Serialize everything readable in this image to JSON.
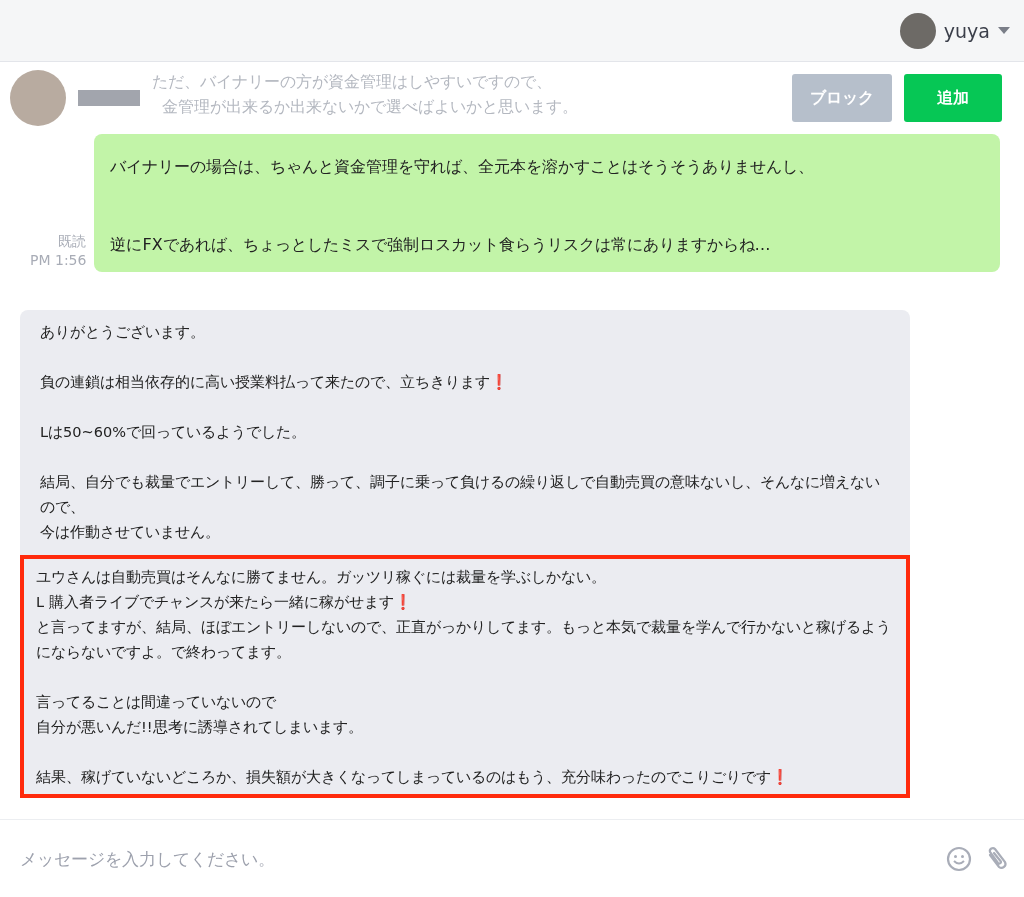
{
  "user_menu": {
    "name": "yuya"
  },
  "faded_message": [
    "ただ、バイナリーの方が資金管理はしやすいですので、",
    "金管理が出来るか出来ないかで選べばよいかと思います。"
  ],
  "contact": {
    "buttons": [
      {
        "kind": "block",
        "label": "ブロック"
      },
      {
        "kind": "add",
        "label": "追加"
      }
    ]
  },
  "sent": {
    "read": "既読",
    "time": "PM 1:56",
    "paragraphs": [
      "バイナリーの場合は、ちゃんと資金管理を守れば、全元本を溶かすことはそうそうありませんし、",
      "逆にFXであれば、ちょっとしたミスで強制ロスカット食らうリスクは常にありますからね…"
    ]
  },
  "received": {
    "blocks": [
      {
        "highlighted": false,
        "paragraphs": [
          [
            "ありがとうございます。"
          ],
          [
            "負の連鎖は相当依存的に高い授業料払って来たので、立ちきります❗"
          ],
          [
            "Lは50~60%で回っているようでした。"
          ],
          [
            "結局、自分でも裁量でエントリーして、勝って、調子に乗って負けるの繰り返しで自動売買の意味ないし、そんなに増えないので、",
            "今は作動させていません。"
          ]
        ]
      },
      {
        "highlighted": true,
        "paragraphs": [
          [
            "ユウさんは自動売買はそんなに勝てません。ガッツリ稼ぐには裁量を学ぶしかない。",
            "L 購入者ライブでチャンスが来たら一緒に稼がせます❗",
            "と言ってますが、結局、ほぼエントリーしないので、正直がっかりしてます。もっと本気で裁量を学んで行かないと稼げるようにならないですよ。で終わってます。"
          ],
          [
            "言ってることは間違っていないので",
            "自分が悪いんだ!!思考に誘導されてしまいます。"
          ],
          [
            "結果、稼げていないどころか、損失額が大きくなってしまっているのはもう、充分味わったのでこりごりです❗"
          ]
        ]
      }
    ]
  },
  "composer": {
    "placeholder": "メッセージを入力してください。"
  }
}
